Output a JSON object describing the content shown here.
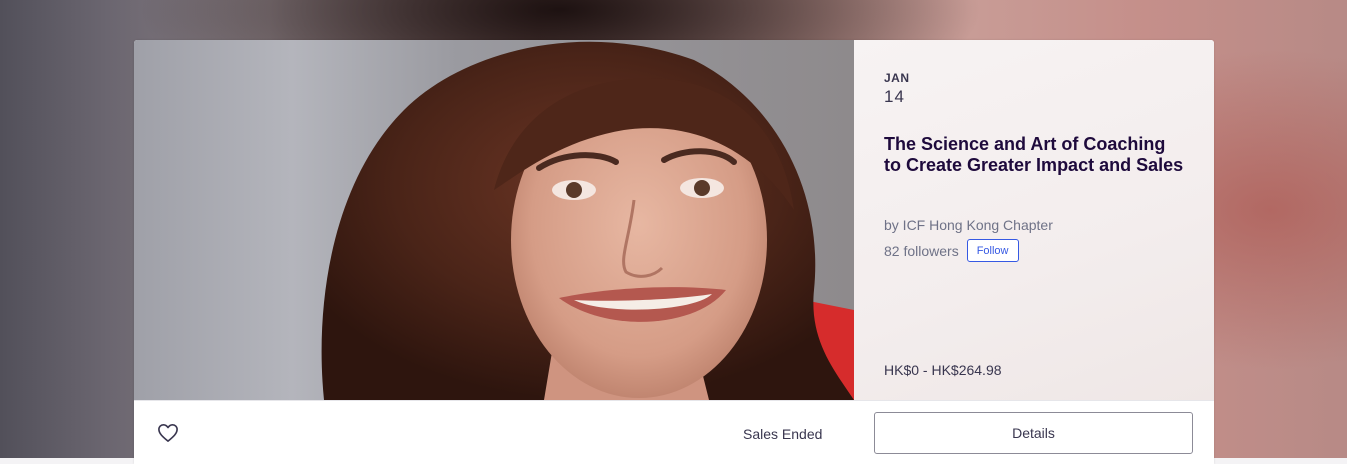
{
  "event": {
    "date": {
      "month": "JAN",
      "day": "14"
    },
    "title": "The Science and Art of Coaching to Create Greater Impact and Sales",
    "organizer": "by ICF Hong Kong Chapter",
    "followers": "82 followers",
    "follow_label": "Follow",
    "price": "HK$0 - HK$264.98",
    "sales_status": "Sales Ended",
    "details_label": "Details"
  },
  "icons": {
    "like": "heart-outline-icon"
  },
  "colors": {
    "title": "#1e0a3c",
    "text": "#39364f",
    "muted": "#6f7287",
    "follow_accent": "#3659e3"
  }
}
